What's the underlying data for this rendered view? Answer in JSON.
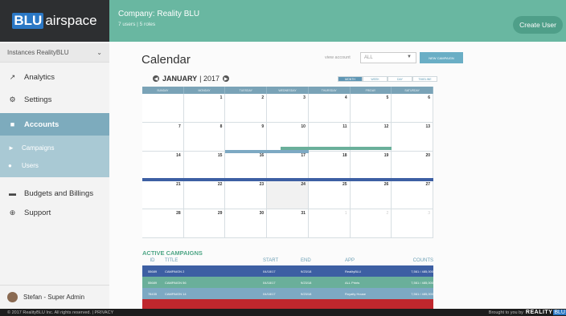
{
  "sidebar": {
    "logo_blu": "BLU",
    "logo_text": "airspace",
    "instances_label": "Instances RealityBLU",
    "items": [
      {
        "label": "Analytics"
      },
      {
        "label": "Settings"
      },
      {
        "label": "Accounts"
      },
      {
        "label": "Campaigns"
      },
      {
        "label": "Users"
      },
      {
        "label": "Budgets and Billings"
      },
      {
        "label": "Support"
      }
    ],
    "user": "Stefan -  Super Admin"
  },
  "header": {
    "company": "Company: Reality BLU",
    "sub": "7 users | 5 roles",
    "create_user": "Create User"
  },
  "main": {
    "title": "Calendar",
    "view_account_label": "view account",
    "account_value": "ALL",
    "new_campaign": "NEW CAMPAIGN",
    "month": "JANUARY",
    "year": "| 2017",
    "views": [
      "MONTH",
      "WEEK",
      "DAY",
      "TIMELINE"
    ],
    "active_view": "MONTH",
    "weekdays": [
      "SUNDAY",
      "MONDAY",
      "TUESDAY",
      "WEDNESDAY",
      "THURSDAY",
      "FRIDAY",
      "SATURDAY"
    ],
    "weeks": [
      [
        "",
        "1",
        "2",
        "3",
        "4",
        "5",
        "6"
      ],
      [
        "7",
        "8",
        "9",
        "10",
        "11",
        "12",
        "13"
      ],
      [
        "14",
        "15",
        "16",
        "17",
        "18",
        "19",
        "20"
      ],
      [
        "21",
        "22",
        "23",
        "24",
        "25",
        "26",
        "27"
      ],
      [
        "28",
        "29",
        "30",
        "31",
        "1",
        "2",
        "3"
      ]
    ],
    "highlight_day": "24"
  },
  "campaigns": {
    "title": "ACTIVE CAMPAIGNS",
    "headers": [
      "ID",
      "TITLE",
      "START",
      "END",
      "APP",
      "COUNTS"
    ],
    "rows": [
      {
        "id": "55689",
        "title": "CAMPAIGN 2",
        "start": "04/18/17",
        "end": "9/23/18",
        "app": "RealityBLU",
        "counts": "7,561 / 485,000",
        "color": "#3d5fa3"
      },
      {
        "id": "55689",
        "title": "CAMPAIGN 56",
        "start": "04/18/17",
        "end": "9/23/18",
        "app": "ALL Prints",
        "counts": "7,561 / 485,000",
        "color": "#6aaf9a"
      },
      {
        "id": "78435",
        "title": "CAMPAIGN 14",
        "start": "04/18/17",
        "end": "9/23/18",
        "app": "Royalty House",
        "counts": "7,561 / 485,000",
        "color": "#7da9c3"
      },
      {
        "id": "",
        "title": "",
        "start": "",
        "end": "",
        "app": "",
        "counts": "",
        "color": "#c0272d"
      }
    ]
  },
  "footer": {
    "copyright": "© 2017 RealityBLU Inc. All rights reserved. | PRIVACY",
    "brought": "Brought to you by",
    "brand": "REALITY",
    "brand_blu": "BLU"
  },
  "colors": {
    "header": "#69b7a1",
    "accent_teal": "#6aaf9a",
    "accent_blue": "#3d5fa3",
    "accent_lightblue": "#7da9c3"
  }
}
